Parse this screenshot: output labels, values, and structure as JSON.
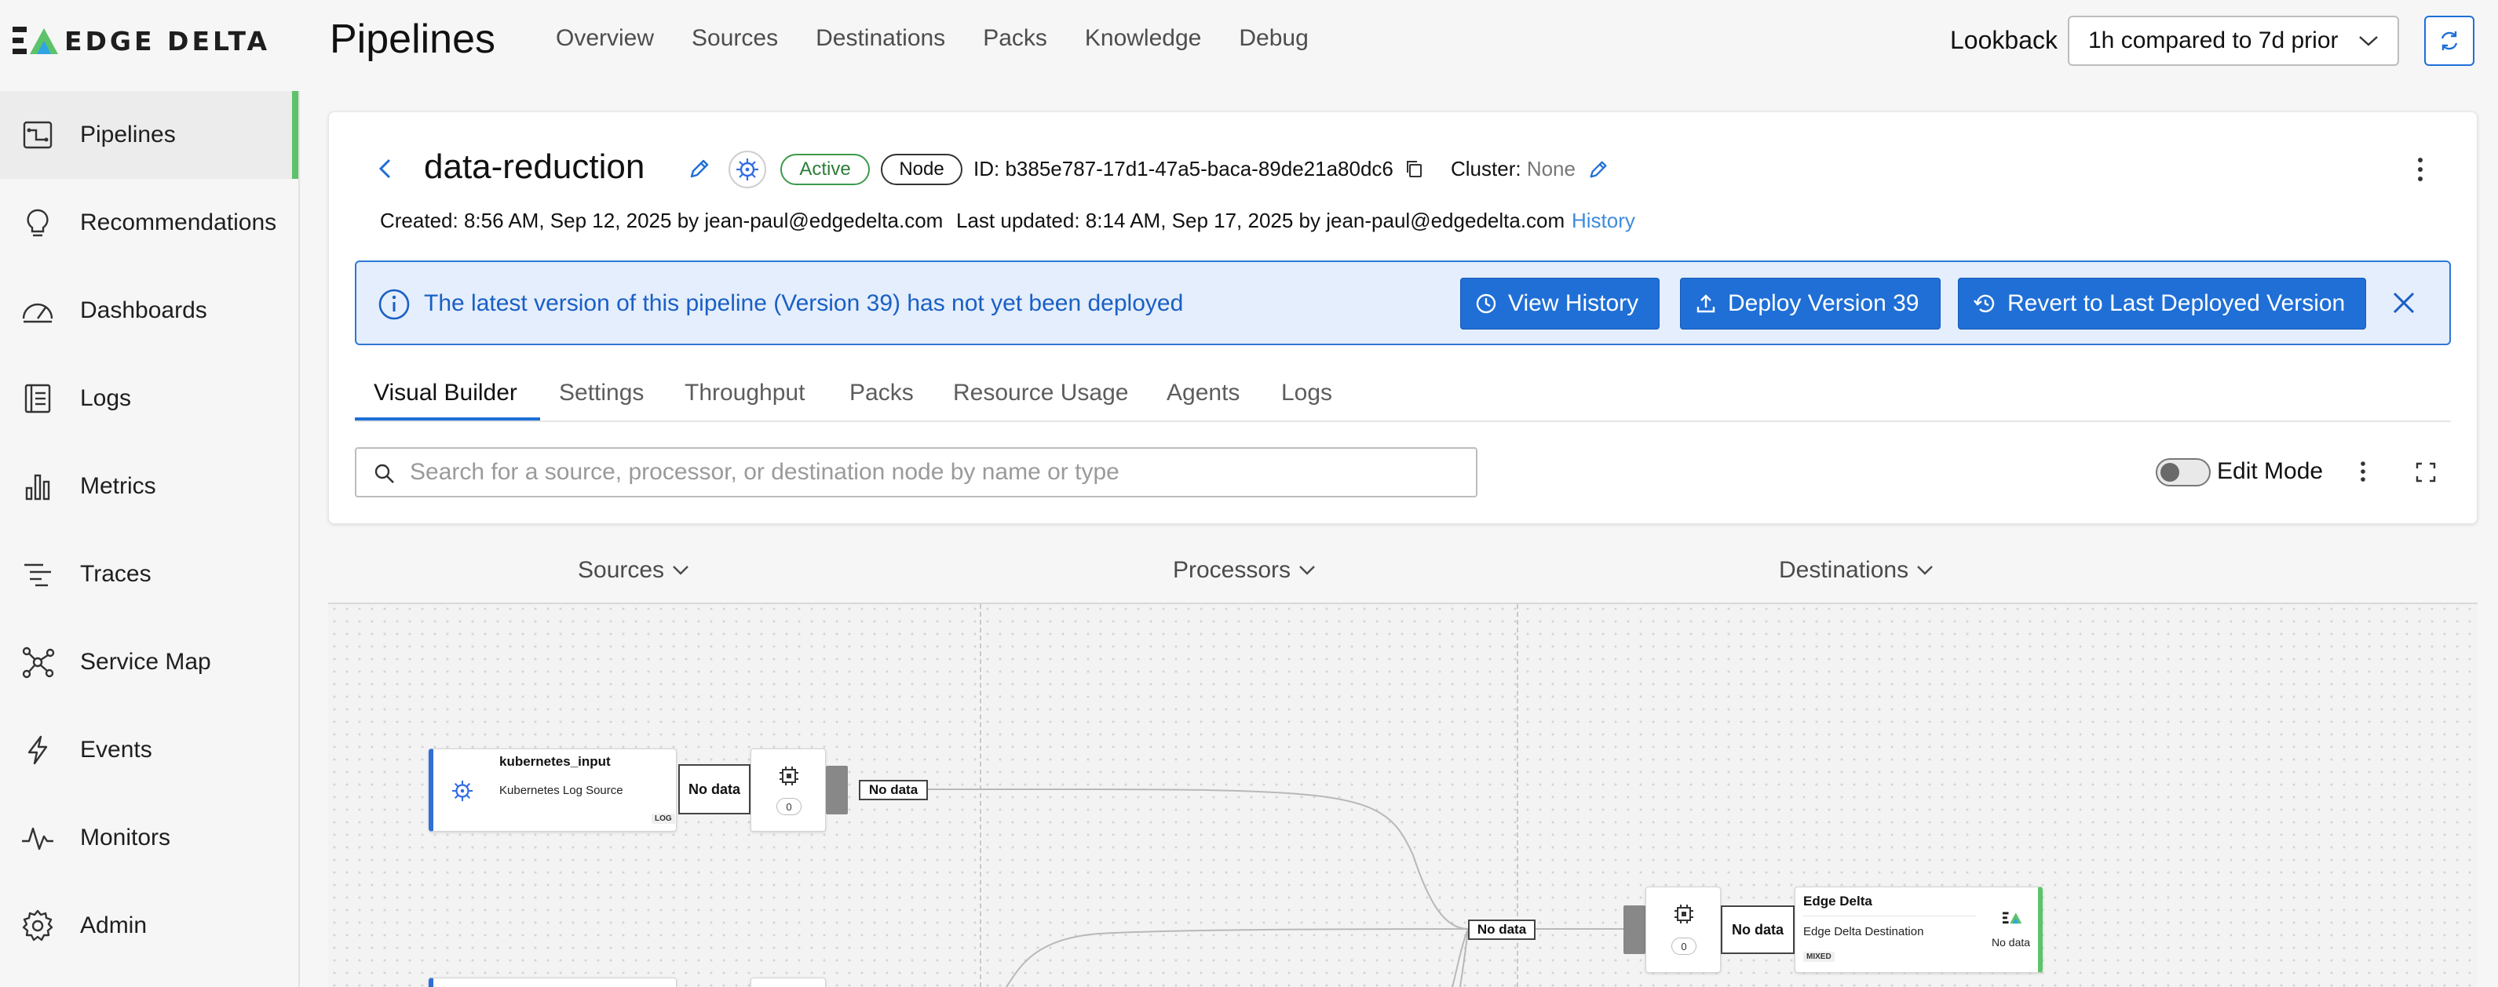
{
  "brand": {
    "name": "EDGE DELTA"
  },
  "header": {
    "title": "Pipelines",
    "nav": [
      "Overview",
      "Sources",
      "Destinations",
      "Packs",
      "Knowledge",
      "Debug"
    ],
    "lookback_label": "Lookback",
    "lookback_value": "1h compared to 7d prior"
  },
  "sidebar": {
    "items": [
      {
        "label": "Pipelines",
        "icon": "pipelines-icon",
        "active": true
      },
      {
        "label": "Recommendations",
        "icon": "lightbulb-icon"
      },
      {
        "label": "Dashboards",
        "icon": "gauge-icon"
      },
      {
        "label": "Logs",
        "icon": "logs-icon"
      },
      {
        "label": "Metrics",
        "icon": "metrics-icon"
      },
      {
        "label": "Traces",
        "icon": "traces-icon"
      },
      {
        "label": "Service Map",
        "icon": "service-map-icon"
      },
      {
        "label": "Events",
        "icon": "lightning-icon"
      },
      {
        "label": "Monitors",
        "icon": "pulse-icon"
      },
      {
        "label": "Admin",
        "icon": "gear-icon"
      }
    ]
  },
  "pipeline": {
    "name": "data-reduction",
    "status": "Active",
    "type": "Node",
    "id": "ID: b385e787-17d1-47a5-baca-89de21a80dc6",
    "cluster_label": "Cluster:",
    "cluster_value": "None",
    "created": "Created: 8:56 AM, Sep 12, 2025 by jean-paul@edgedelta.com",
    "updated": "Last updated: 8:14 AM, Sep 17, 2025 by jean-paul@edgedelta.com",
    "history_link": "History"
  },
  "banner": {
    "message": "The latest version of this pipeline (Version 39) has not yet been deployed",
    "view_history": "View History",
    "deploy": "Deploy Version 39",
    "revert": "Revert to Last Deployed Version"
  },
  "tabs": [
    "Visual Builder",
    "Settings",
    "Throughput",
    "Packs",
    "Resource Usage",
    "Agents",
    "Logs"
  ],
  "active_tab": "Visual Builder",
  "search": {
    "placeholder": "Search for a source, processor, or destination node by name or type"
  },
  "edit_mode": {
    "label": "Edit Mode",
    "on": false
  },
  "columns": [
    "Sources",
    "Processors",
    "Destinations"
  ],
  "graph": {
    "source_node": {
      "title": "kubernetes_input",
      "subtitle": "Kubernetes Log Source",
      "tag": "LOG"
    },
    "destination_node": {
      "title": "Edge Delta",
      "subtitle": "Edge Delta Destination",
      "tag": "MIXED",
      "status": "No data"
    },
    "no_data": "No data",
    "processor_count": "0"
  },
  "colors": {
    "accent": "#1f6fd6",
    "active_green": "#5cc36a",
    "banner_bg": "#e4eefc"
  }
}
